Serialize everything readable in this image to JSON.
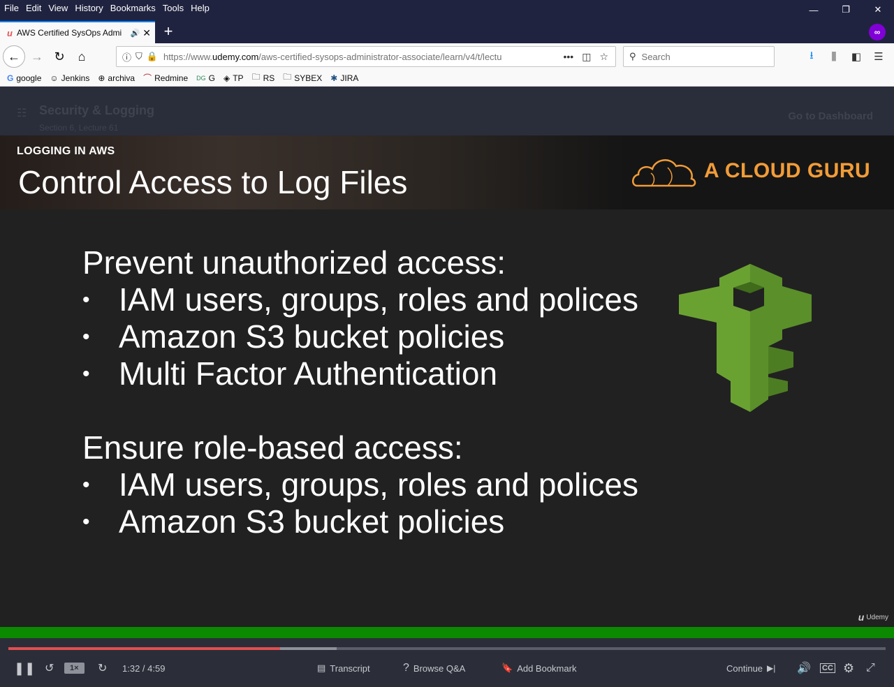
{
  "menu": [
    "File",
    "Edit",
    "View",
    "History",
    "Bookmarks",
    "Tools",
    "Help"
  ],
  "tab": {
    "title": "AWS Certified SysOps Admi"
  },
  "url": {
    "prefix": "https://www.",
    "domain": "udemy.com",
    "path": "/aws-certified-sysops-administrator-associate/learn/v4/t/lectu"
  },
  "search": {
    "placeholder": "Search"
  },
  "bookmarks": [
    "google",
    "Jenkins",
    "archiva",
    "Redmine",
    "G",
    "TP",
    "RS",
    "SYBEX",
    "JIRA"
  ],
  "course_header": {
    "title": "Security & Logging",
    "subtitle": "Section 6, Lecture 61",
    "dashboard": "Go to Dashboard"
  },
  "slide": {
    "kicker": "LOGGING IN AWS",
    "title": "Control Access to Log Files",
    "brand": "A CLOUD GURU",
    "section1_heading": "Prevent unauthorized access:",
    "section1_items": [
      "IAM users, groups, roles and polices",
      "Amazon S3 bucket policies",
      "Multi Factor Authentication"
    ],
    "section2_heading": "Ensure role-based access:",
    "section2_items": [
      "IAM users, groups, roles and polices",
      "Amazon S3 bucket policies"
    ],
    "watermark": "Udemy",
    "colors": {
      "brand": "#f29c38",
      "key_icon": "#6aa232"
    }
  },
  "player": {
    "speed": "1×",
    "time": "1:32 / 4:59",
    "progress_fraction": 0.31,
    "transcript": "Transcript",
    "qa": "Browse Q&A",
    "bookmark": "Add Bookmark",
    "continue": "Continue"
  }
}
